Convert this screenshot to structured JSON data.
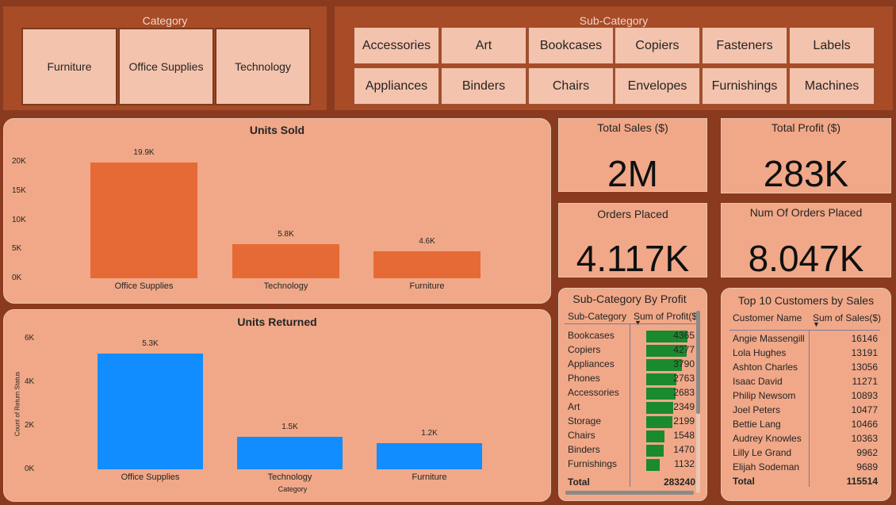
{
  "category_slicer": {
    "title": "Category",
    "items": [
      "Furniture",
      "Office Supplies",
      "Technology"
    ]
  },
  "subcategory_slicer": {
    "title": "Sub-Category",
    "items": [
      "Accessories",
      "Art",
      "Bookcases",
      "Copiers",
      "Fasteners",
      "Labels",
      "Appliances",
      "Binders",
      "Chairs",
      "Envelopes",
      "Furnishings",
      "Machines"
    ]
  },
  "cards": {
    "total_sales": {
      "title": "Total Sales ($)",
      "value": "2M"
    },
    "total_profit": {
      "title": "Total Profit ($)",
      "value": "283K"
    },
    "orders_placed": {
      "title": "Orders Placed",
      "value": "4.117K"
    },
    "num_orders": {
      "title": "Num Of Orders Placed",
      "value": "8.047K"
    }
  },
  "chart_data": [
    {
      "type": "bar",
      "title": "Units Sold",
      "categories": [
        "Office Supplies",
        "Technology",
        "Furniture"
      ],
      "values": [
        19900,
        5800,
        4600
      ],
      "data_labels": [
        "19.9K",
        "5.8K",
        "4.6K"
      ],
      "y_ticks": [
        "20K",
        "15K",
        "10K",
        "5K",
        "0K"
      ],
      "ylim": [
        0,
        20000
      ],
      "color": "#e66a35"
    },
    {
      "type": "bar",
      "title": "Units Returned",
      "categories": [
        "Office Supplies",
        "Technology",
        "Furniture"
      ],
      "values": [
        5300,
        1500,
        1200
      ],
      "data_labels": [
        "5.3K",
        "1.5K",
        "1.2K"
      ],
      "y_ticks": [
        "6K",
        "4K",
        "2K",
        "0K"
      ],
      "ylim": [
        0,
        6000
      ],
      "xlabel": "Category",
      "ylabel": "Count of Return Status",
      "color": "#118dff"
    }
  ],
  "subcat_profit": {
    "title": "Sub-Category By Profit",
    "col1": "Sub-Category",
    "col2": "Sum of Profit($)",
    "rows": [
      {
        "name": "Bookcases",
        "value": "4365",
        "frac": 1.0
      },
      {
        "name": "Copiers",
        "value": "4277",
        "frac": 0.98
      },
      {
        "name": "Appliances",
        "value": "3790",
        "frac": 0.87
      },
      {
        "name": "Phones",
        "value": "2763",
        "frac": 0.73
      },
      {
        "name": "Accessories",
        "value": "2683",
        "frac": 0.72
      },
      {
        "name": "Art",
        "value": "2349",
        "frac": 0.66
      },
      {
        "name": "Storage",
        "value": "2199",
        "frac": 0.63
      },
      {
        "name": "Chairs",
        "value": "1548",
        "frac": 0.45
      },
      {
        "name": "Binders",
        "value": "1470",
        "frac": 0.43
      },
      {
        "name": "Furnishings",
        "value": "1132",
        "frac": 0.33
      }
    ],
    "total_label": "Total",
    "total_value": "283240",
    "bar_color": "#1a8a2e"
  },
  "top_customers": {
    "title": "Top 10 Customers by Sales",
    "col1": "Customer Name",
    "col2": "Sum of Sales($)",
    "rows": [
      {
        "name": "Angie Massengill",
        "value": "16146"
      },
      {
        "name": "Lola Hughes",
        "value": "13191"
      },
      {
        "name": "Ashton Charles",
        "value": "13056"
      },
      {
        "name": "Isaac David",
        "value": "11271"
      },
      {
        "name": "Philip Newsom",
        "value": "10893"
      },
      {
        "name": "Joel Peters",
        "value": "10477"
      },
      {
        "name": "Bettie Lang",
        "value": "10466"
      },
      {
        "name": "Audrey Knowles",
        "value": "10363"
      },
      {
        "name": "Lilly Le Grand",
        "value": "9962"
      },
      {
        "name": "Elijah Sodeman",
        "value": "9689"
      }
    ],
    "total_label": "Total",
    "total_value": "115514"
  }
}
